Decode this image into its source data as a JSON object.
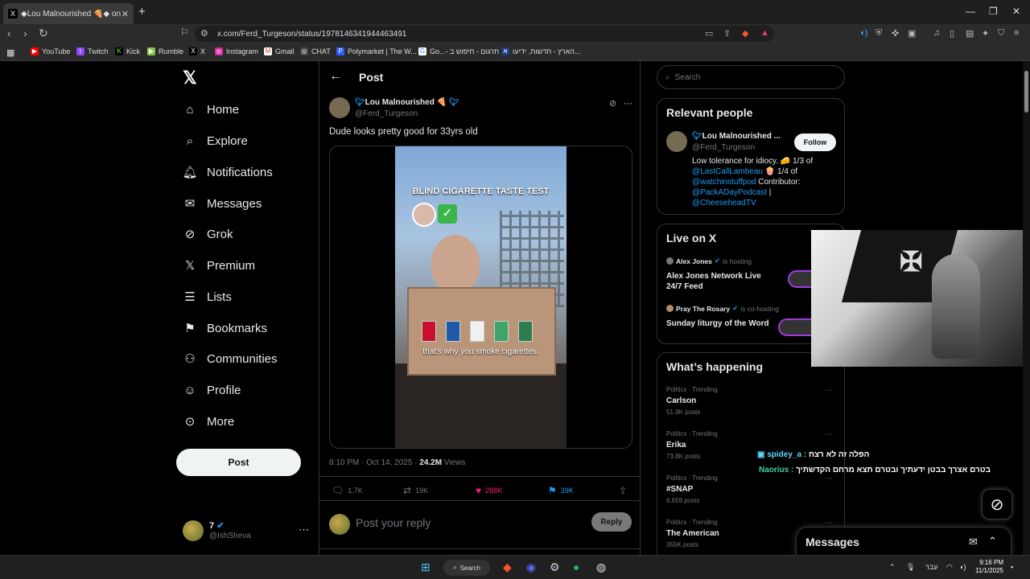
{
  "browser": {
    "tab_title": "◆Lou Malnourished 🍕◆ on",
    "tab_favicon": "X",
    "url": "x.com/Ferd_Turgeson/status/1978146341944463491",
    "bookmarks": [
      {
        "label": "YouTube",
        "color": "#ff0000",
        "glyph": "▶"
      },
      {
        "label": "Twitch",
        "color": "#9146ff",
        "glyph": "t"
      },
      {
        "label": "Kick",
        "color": "#53fc18",
        "glyph": "K"
      },
      {
        "label": "Rumble",
        "color": "#85c742",
        "glyph": "▶"
      },
      {
        "label": "X",
        "color": "#000000",
        "glyph": "X"
      },
      {
        "label": "Instagram",
        "color": "#d6249f",
        "glyph": "◎"
      },
      {
        "label": "Gmail",
        "color": "#ea4335",
        "glyph": "M"
      },
      {
        "label": "CHAT",
        "color": "#444444",
        "glyph": "◎"
      },
      {
        "label": "Polymarket | The W...",
        "color": "#2e5cff",
        "glyph": "P"
      },
      {
        "label": "Go...- תרגום - חיפוש ב",
        "color": "#ffffff",
        "glyph": "G"
      },
      {
        "label": "הארץ - חדשות, ידיעו...",
        "color": "#1f3c88",
        "glyph": "א"
      }
    ]
  },
  "nav": {
    "items": [
      {
        "label": "Home",
        "icon": "⌂"
      },
      {
        "label": "Explore",
        "icon": "⌕"
      },
      {
        "label": "Notifications",
        "icon": "♢"
      },
      {
        "label": "Messages",
        "icon": "✉"
      },
      {
        "label": "Grok",
        "icon": "⊘"
      },
      {
        "label": "Premium",
        "icon": "X"
      },
      {
        "label": "Lists",
        "icon": "☰"
      },
      {
        "label": "Bookmarks",
        "icon": "⚑"
      },
      {
        "label": "Communities",
        "icon": "⚇"
      },
      {
        "label": "Profile",
        "icon": "☺"
      },
      {
        "label": "More",
        "icon": "⋯"
      }
    ],
    "post_button": "Post",
    "account": {
      "name": "7",
      "handle": "@IshSheva"
    }
  },
  "post": {
    "header_title": "Post",
    "author_name": "Lou Malnourished 🍕",
    "author_handle": "@Ferd_Turgeson",
    "text": "Dude looks pretty good for 33yrs old",
    "video": {
      "title": "BLIND CIGARETTE TASTE TEST",
      "caption": "that's why you smoke cigarettes."
    },
    "time": "8:10 PM · Oct 14, 2025 ·",
    "views_count": "24.2M",
    "views_label": "Views",
    "replies": "1.7K",
    "reposts": "19K",
    "likes": "288K",
    "bookmarks": "39K",
    "reply_placeholder": "Post your reply",
    "reply_button": "Reply",
    "like_color": "#f91880",
    "bookmark_color": "#1d9bf0",
    "repost_color": "#71767b"
  },
  "sidebar": {
    "search_placeholder": "Search",
    "relevant": {
      "title": "Relevant people",
      "name": "Lou Malnourished ...",
      "handle": "@Ferd_Turgeson",
      "follow": "Follow",
      "bio_1": "Low tolerance for idiocy. 🧀 1/3 of",
      "bio_link_1": "@LastCallLambeau",
      "bio_2": "🍿 1/4 of",
      "bio_link_2": "@watchinstuffpod",
      "bio_3": "Contributor:",
      "bio_link_3": "@PackADayPodcast",
      "bio_4": "|",
      "bio_link_4": "@CheeseheadTV"
    },
    "live": {
      "title": "Live on X",
      "items": [
        {
          "host": "Alex Jones",
          "status": "is hosting",
          "title": "Alex Jones Network Live 24/7 Feed"
        },
        {
          "host": "Pray The Rosary",
          "status": "is co-hosting",
          "title": "Sunday liturgy of the Word"
        }
      ]
    },
    "happening": {
      "title": "What’s happening",
      "items": [
        {
          "category": "Politics · Trending",
          "name": "Carlson",
          "count": "51.9K posts"
        },
        {
          "category": "Politics · Trending",
          "name": "Erika",
          "count": "73.8K posts"
        },
        {
          "category": "Politics · Trending",
          "name": "#SNAP",
          "count": "6,659 posts"
        },
        {
          "category": "Politics · Trending",
          "name": "The American",
          "count": "355K posts"
        }
      ]
    }
  },
  "chat_overlay": {
    "line1_user": "spidey_a :",
    "line1_text": "הפלה זה לא רצח",
    "line2_user": "Naorius :",
    "line2_text": "בטרם אצרך בבטן ידעתיך ובטרם תצא מרחם הקדשתיך"
  },
  "messages_drawer": {
    "title": "Messages"
  },
  "taskbar": {
    "search": "Search",
    "language": "עבר",
    "time": "9:16 PM",
    "date": "11/1/2025"
  }
}
